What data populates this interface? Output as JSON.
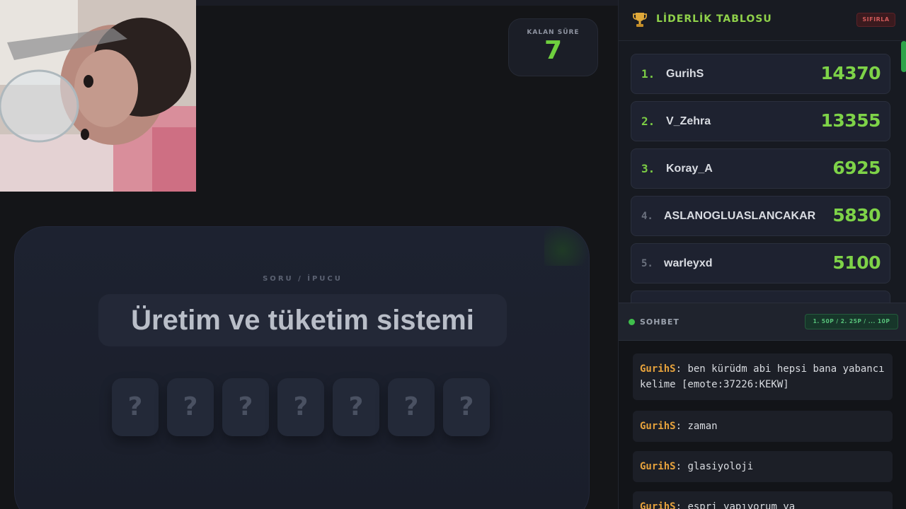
{
  "game": {
    "timer": {
      "label": "KALAN SÜRE",
      "value": "7"
    },
    "question": {
      "label": "SORU / İPUCU",
      "text": "Üretim ve tüketim sistemi",
      "tiles": [
        "?",
        "?",
        "?",
        "?",
        "?",
        "?",
        "?"
      ]
    }
  },
  "leaderboard": {
    "title": "LİDERLİK TABLOSU",
    "reset_label": "SIFIRLA",
    "entries": [
      {
        "rank": "1.",
        "name": "GurihS",
        "score": "14370"
      },
      {
        "rank": "2.",
        "name": "V_Zehra",
        "score": "13355"
      },
      {
        "rank": "3.",
        "name": "Koray_A",
        "score": "6925"
      },
      {
        "rank": "4.",
        "name": "ASLANOGLUASLANCAKAR",
        "score": "5830"
      },
      {
        "rank": "5.",
        "name": "warleyxd",
        "score": "5100"
      }
    ]
  },
  "chat": {
    "title": "SOHBET",
    "points_info": "1. 50P / 2. 25P / ... 10P",
    "messages": [
      {
        "user": "GurihS",
        "text": "ben kürüdm abi hepsi bana yabancı kelime [emote:37226:KEKW]"
      },
      {
        "user": "GurihS",
        "text": "zaman"
      },
      {
        "user": "GurihS",
        "text": "glasiyoloji"
      },
      {
        "user": "GurihS",
        "text": "espri yapıyorum ya"
      }
    ]
  },
  "colors": {
    "accent_green": "#7ed348",
    "username_orange": "#e6a23c",
    "reset_red": "#d05a5a",
    "background": "#141518"
  }
}
